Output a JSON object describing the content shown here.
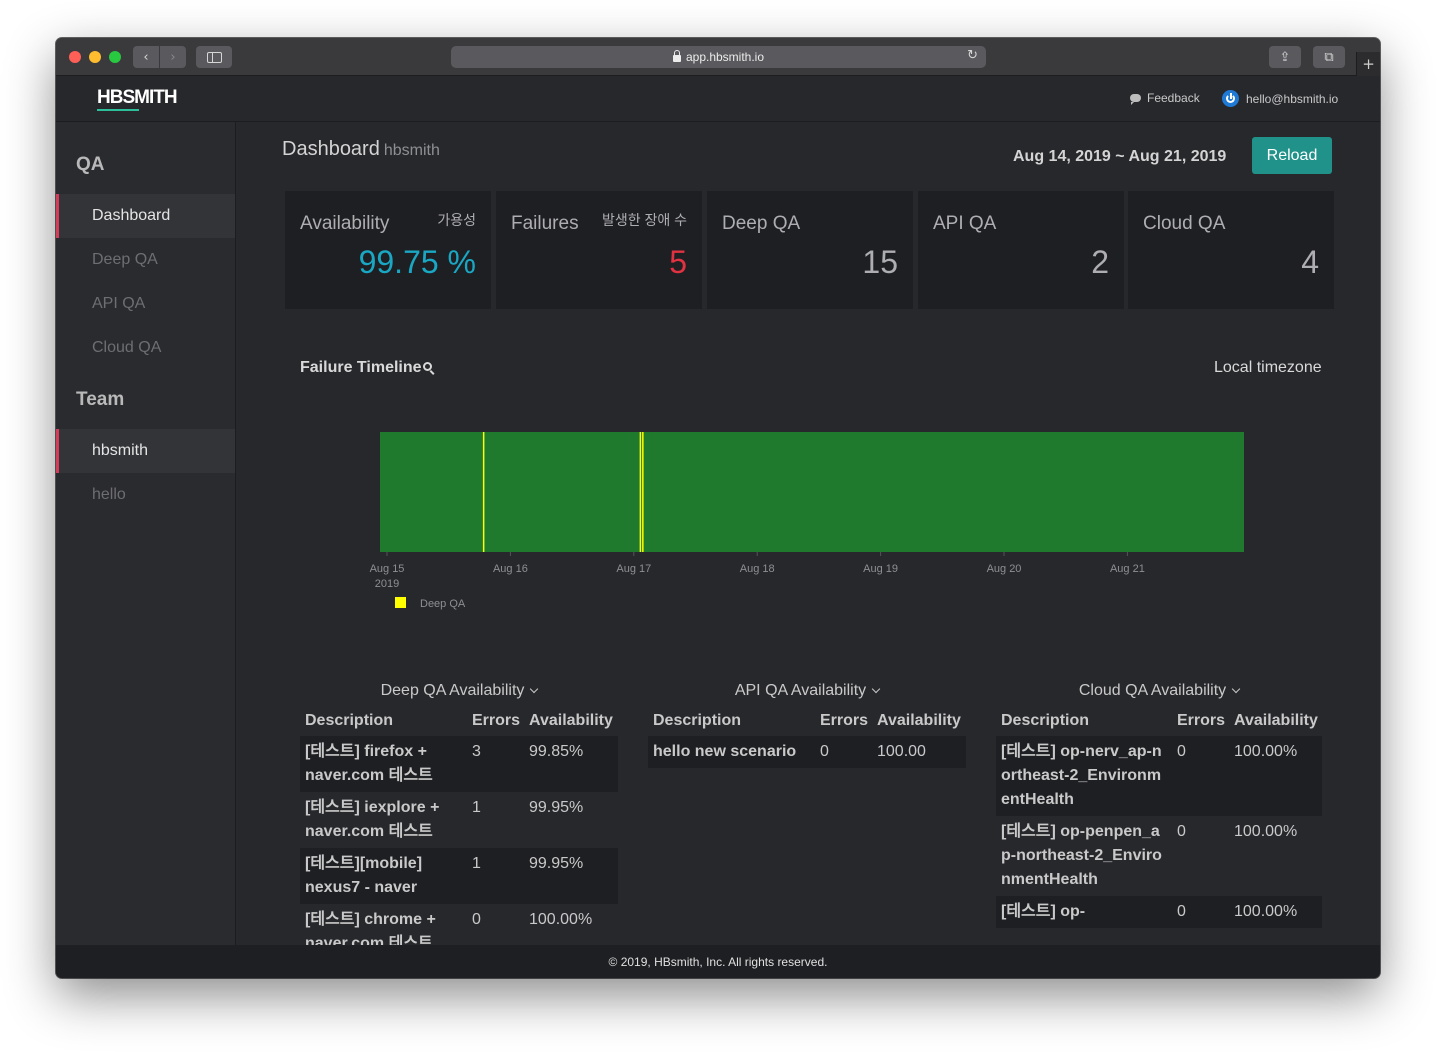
{
  "browser": {
    "url": "app.hbsmith.io"
  },
  "header": {
    "logo": "HBSMITH",
    "feedback_label": "Feedback",
    "user_email": "hello@hbsmith.io"
  },
  "sidebar": {
    "qa_heading": "QA",
    "qa_items": [
      {
        "label": "Dashboard",
        "active": true
      },
      {
        "label": "Deep QA",
        "active": false
      },
      {
        "label": "API QA",
        "active": false
      },
      {
        "label": "Cloud QA",
        "active": false
      }
    ],
    "team_heading": "Team",
    "team_items": [
      {
        "label": "hbsmith",
        "active": true
      },
      {
        "label": "hello",
        "active": false
      }
    ]
  },
  "main": {
    "title": "Dashboard",
    "subtitle": "hbsmith",
    "date_range": "Aug 14, 2019 ~ Aug 21, 2019",
    "reload_label": "Reload",
    "cards": [
      {
        "label": "Availability",
        "sub": "가용성",
        "value": "99.75 %",
        "color": "#1aa7c4"
      },
      {
        "label": "Failures",
        "sub": "발생한 장애 수",
        "value": "5",
        "color": "#e03241"
      },
      {
        "label": "Deep QA",
        "sub": "",
        "value": "15",
        "color": "#aeaeb2"
      },
      {
        "label": "API QA",
        "sub": "",
        "value": "2",
        "color": "#aeaeb2"
      },
      {
        "label": "Cloud QA",
        "sub": "",
        "value": "4",
        "color": "#aeaeb2"
      }
    ],
    "timeline_title": "Failure Timeline",
    "timezone_label": "Local timezone"
  },
  "chart_data": {
    "type": "timeline",
    "title": "Failure Timeline",
    "background_color": "#1f7a2e",
    "failure_color": "#ffff00",
    "x_ticks": [
      "Aug 15",
      "Aug 16",
      "Aug 17",
      "Aug 18",
      "Aug 19",
      "Aug 20",
      "Aug 21"
    ],
    "x_year_label": "2019",
    "x_start_day": 15.0,
    "x_end_day": 22.0,
    "failures": [
      {
        "series": "Deep QA",
        "day": 15.84
      },
      {
        "series": "Deep QA",
        "day": 17.11
      },
      {
        "series": "Deep QA",
        "day": 17.13
      }
    ],
    "legend": [
      {
        "name": "Deep QA",
        "color": "#ffff00"
      }
    ]
  },
  "tables": {
    "deep": {
      "title": "Deep QA Availability",
      "headers": [
        "Description",
        "Errors",
        "Availability"
      ],
      "rows": [
        [
          "[테스트] firefox + naver.com 테스트",
          "3",
          "99.85%"
        ],
        [
          "[테스트] iexplore + naver.com 테스트",
          "1",
          "99.95%"
        ],
        [
          "[테스트][mobile] nexus7 - naver",
          "1",
          "99.95%"
        ],
        [
          "[테스트] chrome + naver.com 테스트",
          "0",
          "100.00%"
        ]
      ]
    },
    "api": {
      "title": "API QA Availability",
      "headers": [
        "Description",
        "Errors",
        "Availability"
      ],
      "rows": [
        [
          "hello new scenario",
          "0",
          "100.00"
        ]
      ]
    },
    "cloud": {
      "title": "Cloud QA Availability",
      "headers": [
        "Description",
        "Errors",
        "Availability"
      ],
      "rows": [
        [
          "[테스트] op-nerv_ap-northeast-2_EnvironmentHealth",
          "0",
          "100.00%"
        ],
        [
          "[테스트] op-penpen_ap-northeast-2_EnvironmentHealth",
          "0",
          "100.00%"
        ],
        [
          "[테스트] op-",
          "0",
          "100.00%"
        ]
      ]
    }
  },
  "footer": {
    "text": "© 2019, HBsmith, Inc. All rights reserved."
  }
}
